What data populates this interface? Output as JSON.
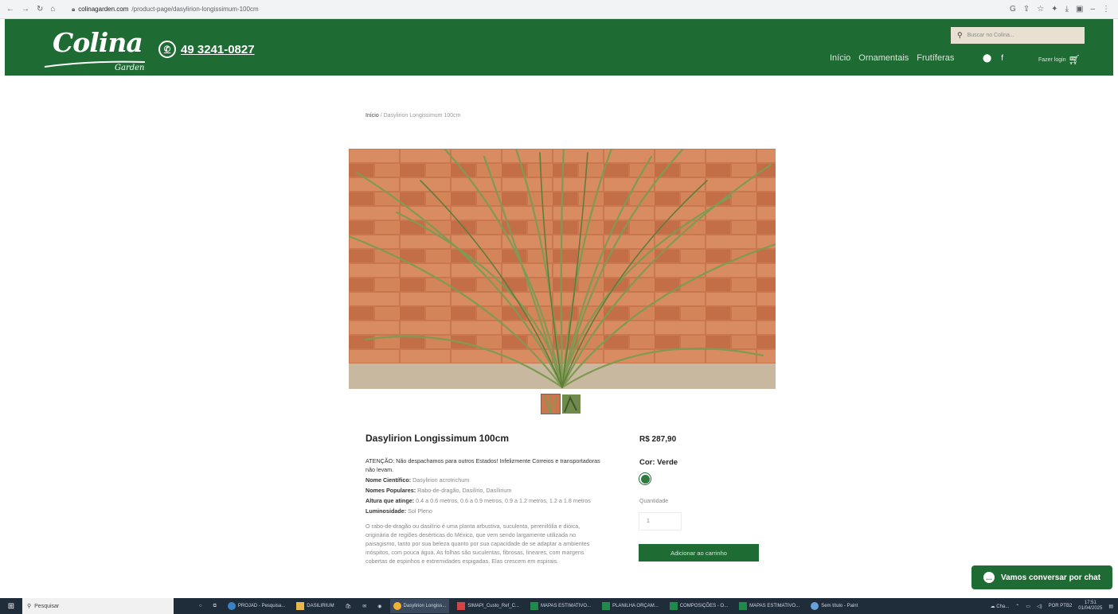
{
  "browser": {
    "url_host": "colinagarden.com",
    "url_path": "/product-page/dasylirion-longissimum-100cm"
  },
  "header": {
    "logo_text": "Colina",
    "logo_sub": "Garden",
    "phone": "49 3241-0827",
    "search_placeholder": "Buscar no Colina...",
    "menu": [
      "Início",
      "Ornamentais",
      "Frutíferas"
    ],
    "login_label": "Fazer login"
  },
  "breadcrumb": {
    "home": "Início",
    "separator": "/",
    "current": "Dasylirion Longissimum 100cm"
  },
  "product": {
    "title": "Dasylirion Longissimum 100cm",
    "price": "R$ 287,90",
    "color_label": "Cor: Verde",
    "color_hex": "#2f7a3c",
    "quantity_label": "Quantidade",
    "quantity_value": "1",
    "add_button": "Adicionar ao carrinho",
    "attention": "ATENÇÃO: Não despachamos para outros Estados! Infelizmente Correios e transportadoras não levam.",
    "sci_name_label": "Nome Científico:",
    "sci_name": "Dasylirion acrotrichum",
    "popular_label": "Nomes Populares:",
    "popular": "Rabo-de-dragão, Dasilírio, Dasílirium",
    "height_label": "Altura que atinge:",
    "height": "0.4 a 0.6 metros, 0.6 a 0.9 metros, 0.9 a 1.2 metros, 1.2 a 1.8 metros",
    "light_label": "Luminosidade:",
    "light": "Sol Pleno",
    "paragraph": "O rabo-de-dragão ou dasilírio é uma planta arbustiva, suculenta, perenifólia e dióica, originária de regiões desérticas do México, que vem sendo largamente utilizada no paisagismo, tanto por sua beleza quanto por sua capacidade de se adaptar a ambientes inóspitos, com pouca água. As folhas são suculentas, fibrosas, lineares, com margens cobertas de espinhos e extremidades espigadas. Elas crescem em espirais."
  },
  "chat": {
    "label": "Vamos conversar por chat"
  },
  "taskbar": {
    "search": "Pesquisar",
    "items": [
      "PROJAD - Pesquisa...",
      "DASILIRIUM",
      "Dasylirion Longiss...",
      "SIMAPI_Custo_Ref_C...",
      "MAPAS ESTIMATIVO...",
      "PLANILHA ORÇAM...",
      "COMPOSIÇÕES - O...",
      "MAPAS ESTIMATIVO...",
      "Sem título - Paint"
    ],
    "tray_chat": "Cha...",
    "lang": "POR PTB2",
    "time": "17:51",
    "date": "01/04/2025"
  }
}
